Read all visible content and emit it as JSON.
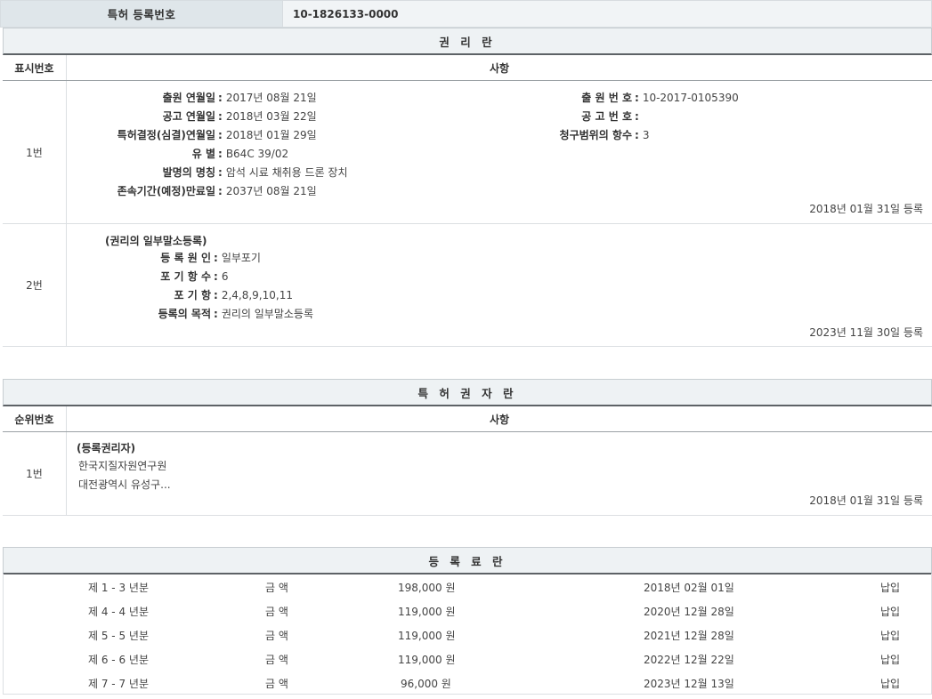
{
  "header": {
    "label": "특허 등록번호",
    "value": "10-1826133-0000"
  },
  "rights": {
    "title": "권 리 란",
    "col_no": "표시번호",
    "col_content": "사항",
    "rows": [
      {
        "no": "1번",
        "left": [
          {
            "label": "출원 연월일",
            "value": "2017년 08월 21일"
          },
          {
            "label": "공고 연월일",
            "value": "2018년 03월 22일"
          },
          {
            "label": "특허결정(심결)연월일",
            "value": "2018년 01월 29일"
          },
          {
            "label": "유 별",
            "value": "B64C 39/02"
          },
          {
            "label": "발명의 명칭",
            "value": "암석 시료 채취용 드론 장치"
          },
          {
            "label": "존속기간(예정)만료일",
            "value": "2037년 08월 21일"
          }
        ],
        "right": [
          {
            "label": "출 원 번 호",
            "value": "10-2017-0105390"
          },
          {
            "label": "공 고 번 호",
            "value": ""
          },
          {
            "label": "청구범위의 항수",
            "value": "3"
          }
        ],
        "date": "2018년 01월 31일 등록"
      },
      {
        "no": "2번",
        "subtitle": "(권리의 일부말소등록)",
        "left": [
          {
            "label": "등 록 원 인",
            "value": "일부포기"
          },
          {
            "label": "포 기 항 수",
            "value": "6"
          },
          {
            "label": "포 기 항",
            "value": "2,4,8,9,10,11"
          },
          {
            "label": "등록의 목적",
            "value": "권리의 일부말소등록"
          }
        ],
        "date": "2023년 11월 30일 등록"
      }
    ]
  },
  "holders": {
    "title": "특 허 권 자 란",
    "col_no": "순위번호",
    "col_content": "사항",
    "rows": [
      {
        "no": "1번",
        "subtitle": "(등록권리자)",
        "lines": [
          "한국지질자원연구원",
          "대전광역시 유성구..."
        ],
        "date": "2018년 01월 31일 등록"
      }
    ]
  },
  "fees": {
    "title": "등 록 료 란",
    "rows": [
      {
        "period": "제 1 - 3 년분",
        "label": "금 액",
        "amount": "198,000 원",
        "date": "2018년 02월 01일",
        "status": "납입"
      },
      {
        "period": "제 4 - 4 년분",
        "label": "금 액",
        "amount": "119,000 원",
        "date": "2020년 12월 28일",
        "status": "납입"
      },
      {
        "period": "제 5 - 5 년분",
        "label": "금 액",
        "amount": "119,000 원",
        "date": "2021년 12월 28일",
        "status": "납입"
      },
      {
        "period": "제 6 - 6 년분",
        "label": "금 액",
        "amount": "119,000 원",
        "date": "2022년 12월 22일",
        "status": "납입"
      },
      {
        "period": "제 7 - 7 년분",
        "label": "금 액",
        "amount": "96,000 원",
        "date": "2023년 12월 13일",
        "status": "납입"
      }
    ]
  }
}
